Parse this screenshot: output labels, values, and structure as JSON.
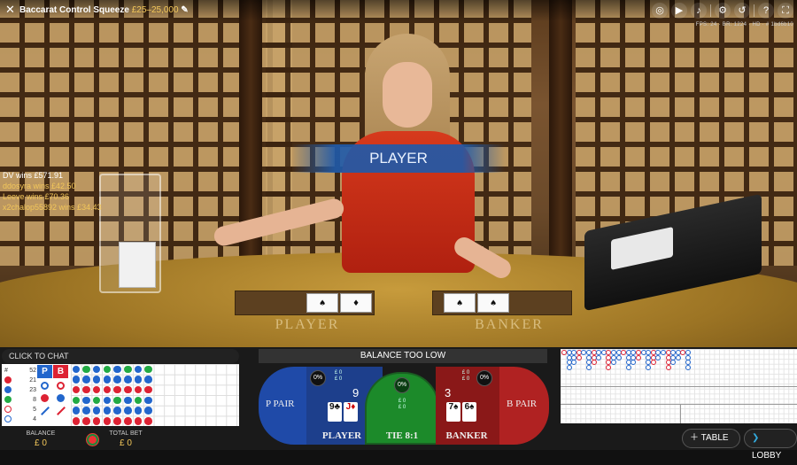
{
  "topbar": {
    "title": "Baccarat Control Squeeze",
    "limits": "£25–25,000",
    "stats": "FPS: 24   ·   BR: 1224   ·   HD   ·   # 1bd6b10"
  },
  "banner": "PLAYER",
  "table_labels": {
    "player": "PLAYER",
    "banker": "BANKER"
  },
  "winners": [
    "DV wins £571.91",
    "ddosyra wins £42.50",
    "Leeve wins £70.36",
    "x2chalop55892 wins £34.43"
  ],
  "chat": {
    "label": "CLICK TO CHAT"
  },
  "bead_stats": [
    {
      "key": "#",
      "value": "52"
    },
    {
      "key": "B",
      "value": "21",
      "color": "#d23"
    },
    {
      "key": "P",
      "value": "23",
      "color": "#26c"
    },
    {
      "key": "T",
      "value": "8",
      "color": "#2a4"
    },
    {
      "key": "",
      "value": "5",
      "color": "#d23"
    },
    {
      "key": "",
      "value": "4",
      "color": "#26c"
    }
  ],
  "predict": {
    "p": "P",
    "b": "B"
  },
  "footer": {
    "balance_label": "BALANCE",
    "balance_value": "£ 0",
    "totalbet_label": "TOTAL BET",
    "totalbet_value": "£ 0"
  },
  "betting": {
    "warning": "BALANCE TOO LOW",
    "p_pair": "P PAIR",
    "player": "PLAYER",
    "tie": "TIE 8:1",
    "banker": "BANKER",
    "b_pair": "B PAIR",
    "player_pct": "0%",
    "tie_pct": "0%",
    "banker_pct": "0%",
    "player_bets": "£ 0\n£ 0",
    "tie_bets": "£ 0\n£ 0",
    "banker_bets": "£ 0\n£ 0",
    "player_score": "9",
    "banker_score": "3",
    "player_cards": [
      "9♣",
      "J♦"
    ],
    "banker_cards": [
      "7♠",
      "6♠"
    ]
  },
  "buttons": {
    "table": "TABLE",
    "lobby": "LOBBY"
  },
  "colors": {
    "accent": "#f3c75a",
    "player": "#1f4aa8",
    "banker": "#b02222",
    "tie": "#1c8a2a"
  }
}
